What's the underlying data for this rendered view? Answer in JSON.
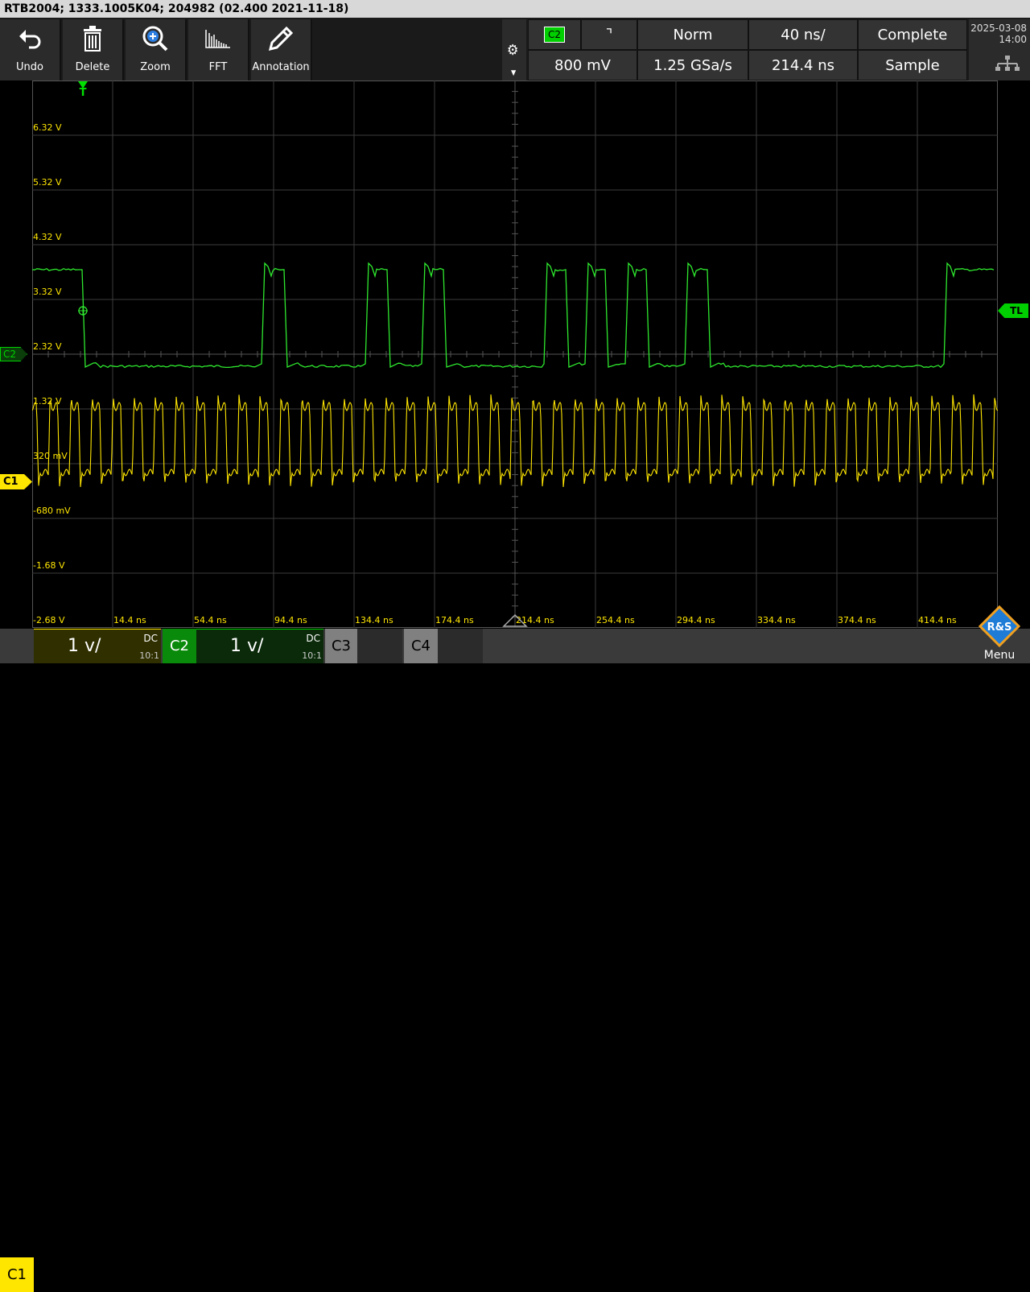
{
  "title_bar": "RTB2004; 1333.1005K04; 204982 (02.400 2021-11-18)",
  "toolbar": [
    {
      "label": "Undo",
      "icon": "undo-icon"
    },
    {
      "label": "Delete",
      "icon": "trash-icon"
    },
    {
      "label": "Zoom",
      "icon": "zoom-icon"
    },
    {
      "label": "FFT",
      "icon": "fft-icon"
    },
    {
      "label": "Annotation",
      "icon": "pencil-icon"
    }
  ],
  "settings": {
    "trigger_source": "C2",
    "trigger_slope": "falling",
    "trigger_mode": "Norm",
    "time_div": "40 ns/",
    "acq_state": "Complete",
    "trigger_level": "800 mV",
    "sample_rate": "1.25 GSa/s",
    "record_length": "214.4 ns",
    "acq_mode": "Sample"
  },
  "datetime": {
    "date": "2025-03-08",
    "time": "14:00"
  },
  "y_labels": [
    "6.32 V",
    "5.32 V",
    "4.32 V",
    "3.32 V",
    "2.32 V",
    "1.32 V",
    "320 mV",
    "-680 mV",
    "-1.68 V",
    "-2.68 V"
  ],
  "x_labels": [
    "14.4 ns",
    "54.4 ns",
    "94.4 ns",
    "134.4 ns",
    "174.4 ns",
    "214.4 ns",
    "254.4 ns",
    "294.4 ns",
    "334.4 ns",
    "374.4 ns",
    "414.4 ns"
  ],
  "markers": {
    "trigger": "T",
    "trigger_level": "TL",
    "c2": "C2",
    "c1": "C1"
  },
  "channels": [
    {
      "name": "C1",
      "scale": "1 v/",
      "coupling": "DC",
      "probe": "10:1",
      "color": "#ffe600"
    },
    {
      "name": "C2",
      "scale": "1 v/",
      "coupling": "DC",
      "probe": "10:1",
      "color": "#00d000"
    },
    {
      "name": "C3"
    },
    {
      "name": "C4"
    }
  ],
  "menu_label": "Menu",
  "logo_text": "R&S"
}
